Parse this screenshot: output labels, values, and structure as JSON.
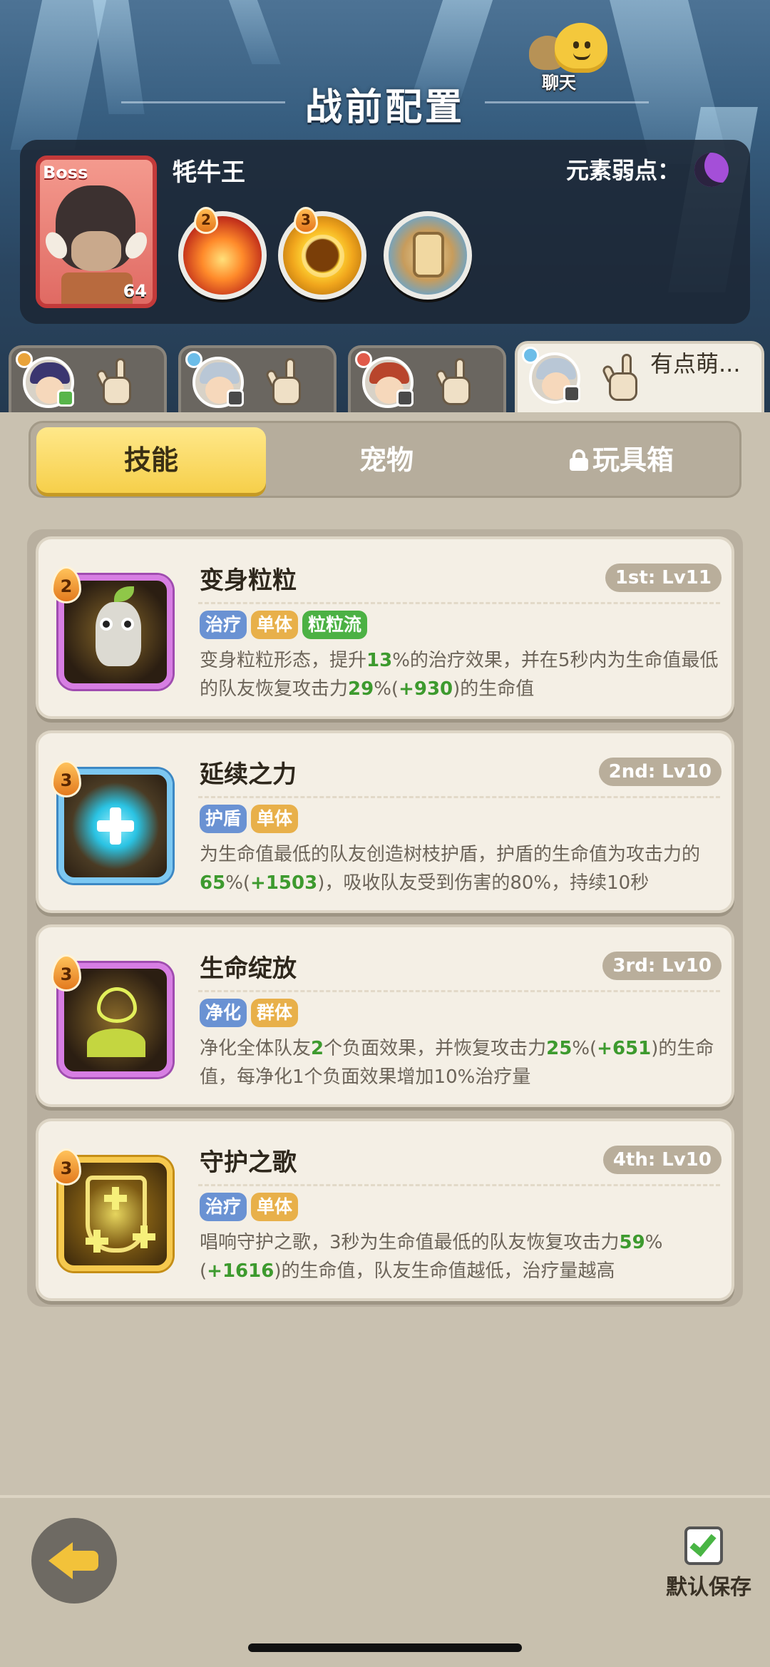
{
  "header": {
    "title": "战前配置",
    "chat_label": "聊天"
  },
  "boss": {
    "tag": "Boss",
    "name": "牦牛王",
    "level": "64",
    "element_weakness_label": "元素弱点：",
    "element_weakness_icon": "moon-icon",
    "skills": [
      {
        "icon": "fire-claw-icon",
        "badge": "2"
      },
      {
        "icon": "golden-ring-icon",
        "badge": "3"
      },
      {
        "icon": "stone-fist-icon",
        "badge": ""
      }
    ]
  },
  "heroes": [
    {
      "name": "hero-1",
      "text": ""
    },
    {
      "name": "hero-2",
      "text": ""
    },
    {
      "name": "hero-3",
      "text": ""
    },
    {
      "name": "hero-4",
      "text": "有点萌..."
    }
  ],
  "tabs": {
    "skills": "技能",
    "pets": "宠物",
    "toybox": "玩具箱",
    "active": "技能"
  },
  "skills": [
    {
      "name": "变身粒粒",
      "cost": "2",
      "level": "1st: Lv11",
      "tags": [
        "治疗",
        "单体",
        "粒粒流"
      ],
      "desc_a": "变身粒粒形态，提升",
      "v1": "13",
      "desc_b": "%的治疗效果，并在5秒内为生命值最低的队友恢复攻击力",
      "v2": "29",
      "desc_c": "%(",
      "v3": "+930",
      "desc_d": ")的生命值"
    },
    {
      "name": "延续之力",
      "cost": "3",
      "level": "2nd: Lv10",
      "tags": [
        "护盾",
        "单体"
      ],
      "desc_a": "为生命值最低的队友创造树枝护盾，护盾的生命值为攻击力的",
      "v1": "65",
      "desc_b": "%(",
      "v2": "+1503",
      "desc_c": ")，吸收队友受到伤害的80%，持续10秒"
    },
    {
      "name": "生命绽放",
      "cost": "3",
      "level": "3rd: Lv10",
      "tags": [
        "净化",
        "群体"
      ],
      "desc_a": "净化全体队友",
      "v1": "2",
      "desc_b": "个负面效果，并恢复攻击力",
      "v2": "25",
      "desc_c": "%(",
      "v3": "+651",
      "desc_d": ")的生命值，每净化1个负面效果增加10%治疗量"
    },
    {
      "name": "守护之歌",
      "cost": "3",
      "level": "4th: Lv10",
      "tags": [
        "治疗",
        "单体"
      ],
      "desc_a": "唱响守护之歌，3秒为生命值最低的队友恢复攻击力",
      "v1": "59",
      "desc_b": "%(",
      "v2": "+1616",
      "desc_c": ")的生命值，队友生命值越低，治疗量越高"
    }
  ],
  "footer": {
    "save_label": "默认保存",
    "save_checked": true
  },
  "colors": {
    "highlight_value": "#3d9a2e",
    "active_tab": "#f6cf4a",
    "boss_frame": "#c33a3a"
  }
}
